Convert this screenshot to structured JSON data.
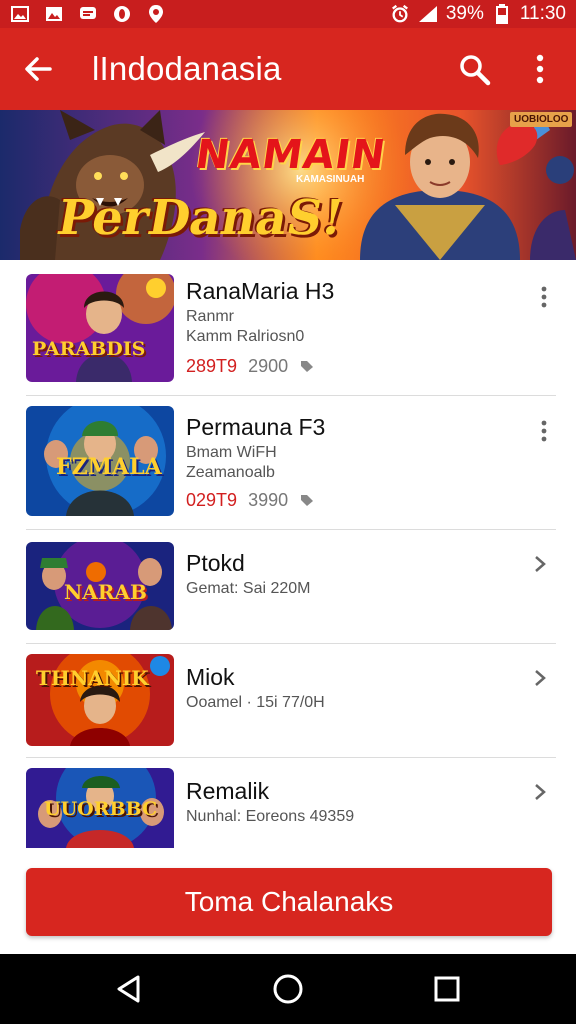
{
  "status_bar": {
    "battery_percent": "39%",
    "time": "11:30",
    "icons": [
      "image-icon",
      "image-icon",
      "chat-icon",
      "opera-icon",
      "location-icon",
      "alarm-icon",
      "signal-icon"
    ]
  },
  "app_bar": {
    "title": "lIndodanasia",
    "icons": [
      "back-arrow-icon",
      "search-icon",
      "more-vert-icon"
    ]
  },
  "banner": {
    "headline_1": "NAMAIN",
    "headline_2": "PerDanaS!",
    "sub_text": "KAMASINUAH",
    "badge": "UOBIOLOO"
  },
  "games": [
    {
      "title": "RanaMaria H3",
      "line1": "Ranmr",
      "line2": "Kamm Ralriosn0",
      "price": "289T9",
      "price_old": "2900",
      "action_icon": "more-vert-icon",
      "thumb_text": "PARABDIS",
      "thumb_colors": [
        "#7b1fa2",
        "#e91e63",
        "#ff9800"
      ]
    },
    {
      "title": "Permauna F3",
      "line1": "Bmam WiFH",
      "line2": "Zeamanoalb",
      "price": "029T9",
      "price_old": "3990",
      "action_icon": "more-vert-icon",
      "thumb_text": "FZMALA",
      "thumb_colors": [
        "#0d47a1",
        "#1976d2",
        "#ff6f00"
      ]
    },
    {
      "title": "Ptokd",
      "line1": "Gemat: Sai 220M",
      "action_icon": "chevron-right-icon",
      "thumb_text": "NARAB",
      "thumb_colors": [
        "#1a237e",
        "#6a1b9a",
        "#ef6c00"
      ]
    },
    {
      "title": "Miok",
      "line1": "Ooamel · 15i 77/0H",
      "action_icon": "chevron-right-icon",
      "thumb_text": "THNANIK",
      "thumb_colors": [
        "#b71c1c",
        "#e65100",
        "#ffb300"
      ]
    },
    {
      "title": "Remalik",
      "line1": "Nunhal: Eoreons 49359",
      "action_icon": "chevron-right-icon",
      "thumb_text": "UUORBBC",
      "thumb_colors": [
        "#311b92",
        "#1565c0",
        "#c62828"
      ]
    }
  ],
  "cta": {
    "label": "Toma Chalanaks"
  },
  "nav": {
    "icons": [
      "back-triangle-icon",
      "home-circle-icon",
      "recents-square-icon"
    ]
  },
  "colors": {
    "primary": "#d7261f",
    "status_bar": "#c81e1e",
    "price": "#d21f1f"
  }
}
